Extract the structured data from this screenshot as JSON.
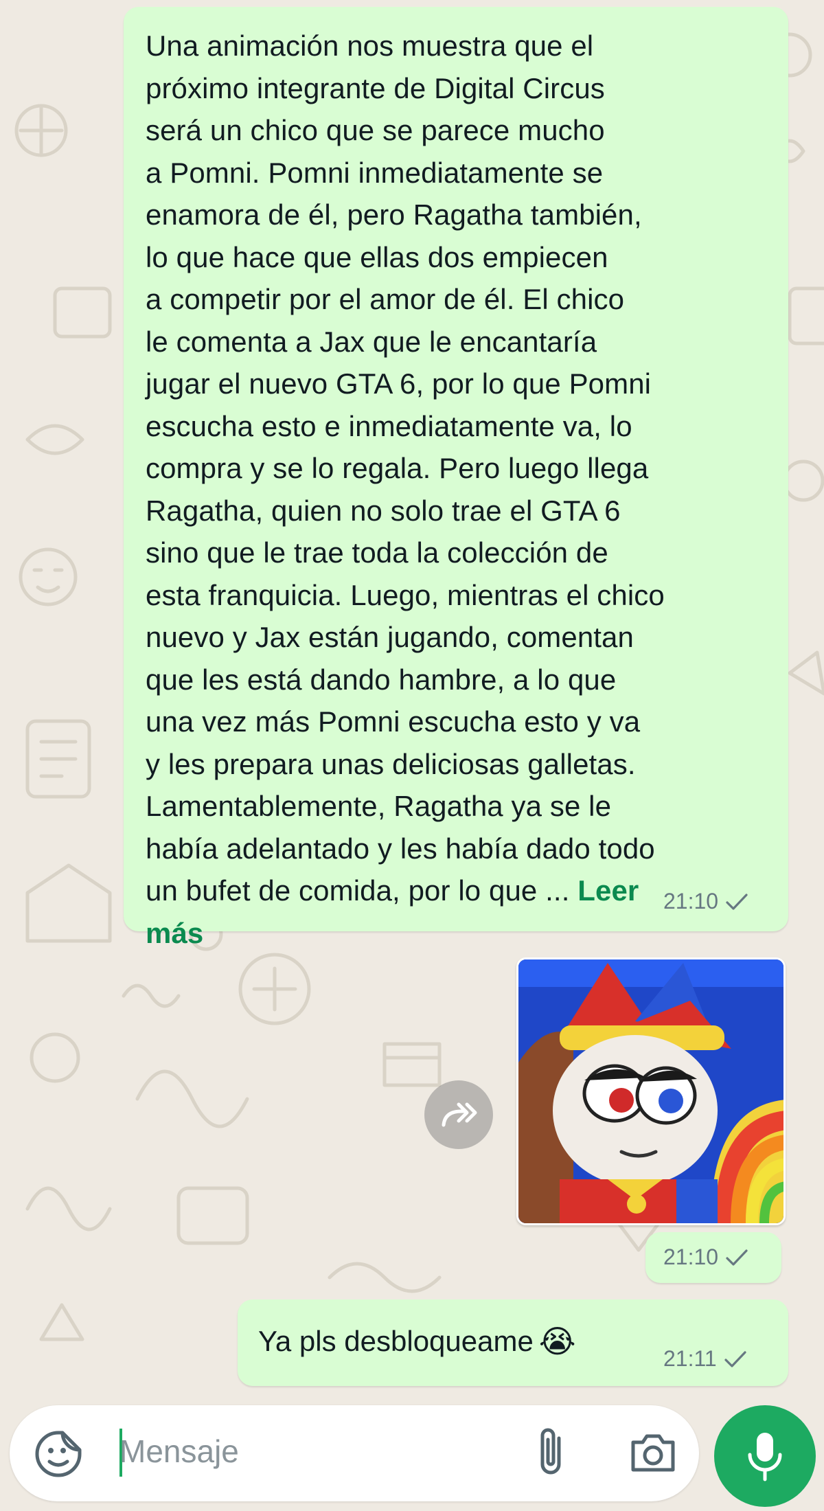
{
  "messages": [
    {
      "type": "text",
      "text": "Una animación nos muestra que el\npróximo integrante de Digital Circus\nserá un chico que se parece mucho\na Pomni. Pomni inmediatamente se\nenamora de él, pero Ragatha también,\nlo que hace que ellas dos empiecen\na competir por el amor de él. El chico\nle comenta a Jax que le encantaría\njugar el nuevo GTA 6, por lo que Pomni\nescucha esto e inmediatamente va, lo\ncompra y se lo regala. Pero luego llega\nRagatha, quien no solo trae el GTA 6\nsino que le trae toda la colección de\nesta franquicia. Luego, mientras el chico\nnuevo y Jax están jugando, comentan\nque les está dando hambre, a lo que\nuna vez más Pomni escucha esto y va\ny les prepara unas deliciosas galletas.\nLamentablemente, Ragatha ya se le\nhabía adelantado y les había dado todo\nun bufet de comida, por lo que ... ",
      "read_more": "Leer\nmás",
      "time": "21:10"
    },
    {
      "type": "image",
      "image_desc": "cartoon-jester-character",
      "time": "21:10"
    },
    {
      "type": "text",
      "text": "Ya pls desbloqueame",
      "emoji": "😭",
      "time": "21:11"
    }
  ],
  "composer": {
    "placeholder": "Mensaje"
  },
  "icons": {
    "sticker": "sticker-icon",
    "attach": "paperclip-icon",
    "camera": "camera-icon",
    "mic": "microphone-icon",
    "forward": "forward-icon",
    "tick": "single-check-icon"
  },
  "colors": {
    "outgoing_bubble": "#d9fdd3",
    "background": "#efeae2",
    "accent": "#1daa61",
    "read_more": "#0b8a4f",
    "meta": "#667781"
  }
}
